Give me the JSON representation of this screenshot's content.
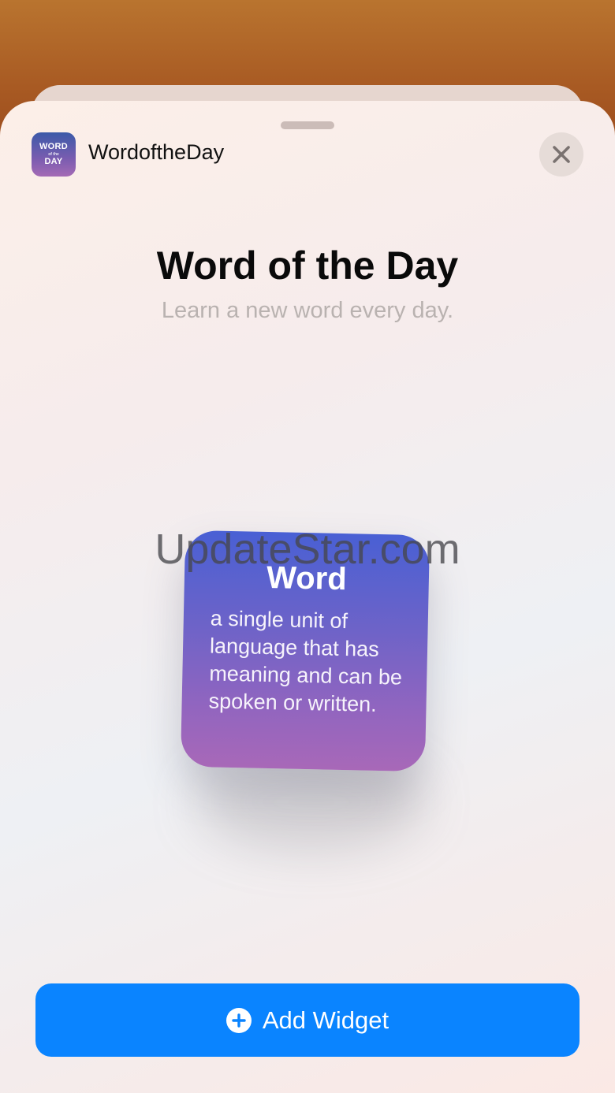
{
  "app": {
    "icon": {
      "line1": "WORD",
      "line2": "of the",
      "line3": "DAY"
    },
    "name": "WordoftheDay"
  },
  "header": {
    "close_icon": "close-icon"
  },
  "widget_info": {
    "title": "Word of the Day",
    "subtitle": "Learn a new word every day."
  },
  "widget": {
    "word": "Word",
    "definition": "a single unit of language that has meaning and can be spoken or written."
  },
  "watermark": "UpdateStar.com",
  "add_button": {
    "label": "Add Widget",
    "icon": "plus-circle-icon",
    "color": "#0a84ff"
  }
}
